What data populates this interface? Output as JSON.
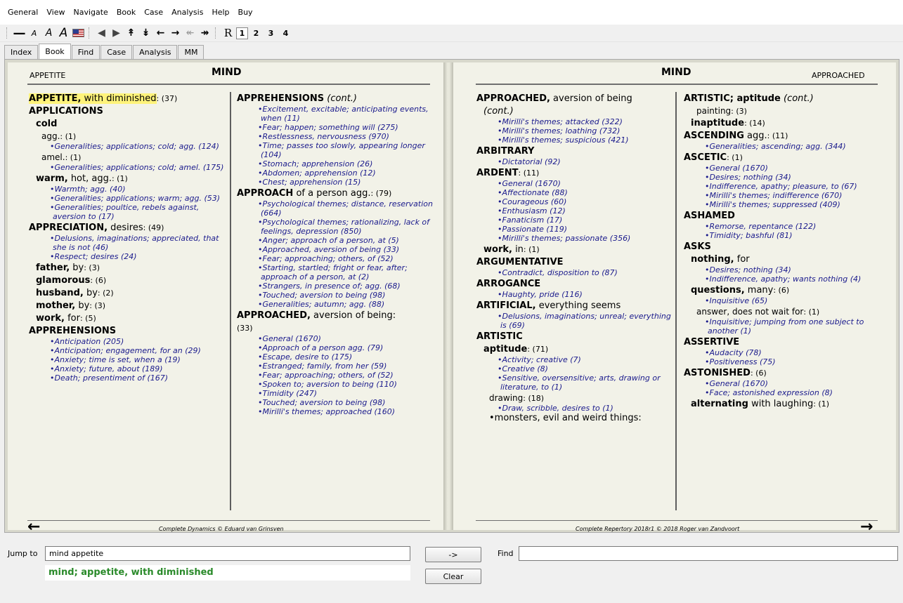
{
  "menu": [
    "General",
    "View",
    "Navigate",
    "Book",
    "Case",
    "Analysis",
    "Help",
    "Buy"
  ],
  "toolbar": {
    "r_label": "R",
    "levels": [
      "1",
      "2",
      "3",
      "4"
    ]
  },
  "tabs": [
    "Index",
    "Book",
    "Find",
    "Case",
    "Analysis",
    "MM"
  ],
  "left_page": {
    "header_label": "APPETITE",
    "header_title": "MIND",
    "footer": "Complete Dynamics © Eduard van Grinsven"
  },
  "right_page": {
    "header_label": "APPROACHED",
    "header_title": "MIND",
    "footer": "Complete Repertory 2018r1 © 2018 Roger van Zandvoort"
  },
  "jump": {
    "label": "Jump to",
    "value": "mind appetite",
    "result_prefix": "mind",
    "result_rest": "; appetite, with diminished"
  },
  "buttons": {
    "go": "->",
    "clear": "Clear"
  },
  "find": {
    "label": "Find",
    "value": ""
  },
  "columns": {
    "c1": [
      {
        "t": "h",
        "lvl": 0,
        "b": "APPETITE,",
        "n": " with diminished",
        "c": ": (37)",
        "hl": true
      },
      {
        "t": "h",
        "lvl": 0,
        "b": "APPLICATIONS"
      },
      {
        "t": "h",
        "lvl": 1,
        "b": "cold"
      },
      {
        "t": "h",
        "lvl": 2,
        "n": "agg.",
        "c": ": (1)"
      },
      {
        "t": "r",
        "x": "Generalities; applications; cold; agg. (124)"
      },
      {
        "t": "h",
        "lvl": 2,
        "n": "amel.",
        "c": ": (1)"
      },
      {
        "t": "r",
        "x": "Generalities; applications; cold; amel. (175)"
      },
      {
        "t": "h",
        "lvl": 1,
        "b": "warm,",
        "n": " hot, agg.",
        "c": ": (1)"
      },
      {
        "t": "r",
        "x": "Warmth; agg. (40)"
      },
      {
        "t": "r",
        "x": "Generalities; applications; warm; agg. (53)"
      },
      {
        "t": "r",
        "x": "Generalities; poultice, rebels against, aversion to (17)"
      },
      {
        "t": "h",
        "lvl": 0,
        "b": "APPRECIATION,",
        "n": " desires",
        "c": ": (49)"
      },
      {
        "t": "r",
        "x": "Delusions, imaginations; appreciated, that she is not (46)"
      },
      {
        "t": "r",
        "x": "Respect; desires (24)"
      },
      {
        "t": "h",
        "lvl": 1,
        "b": "father,",
        "n": " by",
        "c": ": (3)"
      },
      {
        "t": "h",
        "lvl": 1,
        "b": "glamorous",
        "c": ": (6)"
      },
      {
        "t": "h",
        "lvl": 1,
        "b": "husband,",
        "n": " by",
        "c": ": (2)"
      },
      {
        "t": "h",
        "lvl": 1,
        "b": "mother,",
        "n": " by",
        "c": ": (3)"
      },
      {
        "t": "h",
        "lvl": 1,
        "b": "work,",
        "n": " for",
        "c": ": (5)"
      },
      {
        "t": "h",
        "lvl": 0,
        "b": "APPREHENSIONS"
      },
      {
        "t": "r",
        "x": "Anticipation (205)"
      },
      {
        "t": "r",
        "x": "Anticipation; engagement, for an (29)"
      },
      {
        "t": "r",
        "x": "Anxiety; time is set, when a (19)"
      },
      {
        "t": "r",
        "x": "Anxiety; future, about (189)"
      },
      {
        "t": "r",
        "x": "Death; presentiment of (167)"
      }
    ],
    "c2": [
      {
        "t": "h",
        "lvl": 0,
        "b": "APPREHENSIONS",
        "i": " (cont.)"
      },
      {
        "t": "r",
        "x": "Excitement, excitable; anticipating events, when (11)"
      },
      {
        "t": "r",
        "x": "Fear; happen; something will (275)"
      },
      {
        "t": "r",
        "x": "Restlessness, nervousness (970)"
      },
      {
        "t": "r",
        "x": "Time; passes too slowly, appearing longer (104)"
      },
      {
        "t": "r",
        "x": "Stomach; apprehension (26)"
      },
      {
        "t": "r",
        "x": "Abdomen; apprehension (12)"
      },
      {
        "t": "r",
        "x": "Chest; apprehension (15)"
      },
      {
        "t": "h",
        "lvl": 0,
        "b": "APPROACH",
        "n": " of a person agg.",
        "c": ": (79)"
      },
      {
        "t": "r",
        "x": "Psychological themes; distance, reservation (664)"
      },
      {
        "t": "r",
        "x": "Psychological themes; rationalizing, lack of feelings, depression (850)"
      },
      {
        "t": "r",
        "x": "Anger; approach of a person, at (5)"
      },
      {
        "t": "r",
        "x": "Approached, aversion of being (33)"
      },
      {
        "t": "r",
        "x": "Fear; approaching; others, of (52)"
      },
      {
        "t": "r",
        "x": "Starting, startled; fright or fear, after; approach of a person, at (2)"
      },
      {
        "t": "r",
        "x": "Strangers, in presence of; agg. (68)"
      },
      {
        "t": "r",
        "x": "Touched; aversion to being (98)"
      },
      {
        "t": "r",
        "x": "Generalities; autumn; agg. (88)"
      },
      {
        "t": "h",
        "lvl": 0,
        "b": "APPROACHED,",
        "n": " aversion of being:"
      },
      {
        "t": "h",
        "lvl": 0,
        "c": "(33)"
      },
      {
        "t": "r",
        "x": "General (1670)"
      },
      {
        "t": "r",
        "x": "Approach of a person agg. (79)"
      },
      {
        "t": "r",
        "x": "Escape, desire to (175)"
      },
      {
        "t": "r",
        "x": "Estranged; family, from her (59)"
      },
      {
        "t": "r",
        "x": "Fear; approaching; others, of (52)"
      },
      {
        "t": "r",
        "x": "Spoken to; aversion to being (110)"
      },
      {
        "t": "r",
        "x": "Timidity (247)"
      },
      {
        "t": "r",
        "x": "Touched; aversion to being (98)"
      },
      {
        "t": "r",
        "x": "Mirilli's themes; approached (160)"
      }
    ],
    "c3": [
      {
        "t": "h",
        "lvl": 0,
        "b": "APPROACHED,",
        "n": " aversion of being"
      },
      {
        "t": "h",
        "lvl": 1,
        "i": "(cont.)"
      },
      {
        "t": "r",
        "x": "Mirilli's themes; attacked (322)"
      },
      {
        "t": "r",
        "x": "Mirilli's themes; loathing (732)"
      },
      {
        "t": "r",
        "x": "Mirilli's themes; suspicious (421)"
      },
      {
        "t": "h",
        "lvl": 0,
        "b": "ARBITRARY"
      },
      {
        "t": "r",
        "x": "Dictatorial (92)"
      },
      {
        "t": "h",
        "lvl": 0,
        "b": "ARDENT",
        "c": ": (11)"
      },
      {
        "t": "r",
        "x": "General (1670)"
      },
      {
        "t": "r",
        "x": "Affectionate (88)"
      },
      {
        "t": "r",
        "x": "Courageous (60)"
      },
      {
        "t": "r",
        "x": "Enthusiasm (12)"
      },
      {
        "t": "r",
        "x": "Fanaticism (17)"
      },
      {
        "t": "r",
        "x": "Passionate (119)"
      },
      {
        "t": "r",
        "x": "Mirilli's themes; passionate (356)"
      },
      {
        "t": "h",
        "lvl": 1,
        "b": "work,",
        "n": " in",
        "c": ": (1)"
      },
      {
        "t": "h",
        "lvl": 0,
        "b": "ARGUMENTATIVE"
      },
      {
        "t": "r",
        "x": "Contradict, disposition to (87)"
      },
      {
        "t": "h",
        "lvl": 0,
        "b": "ARROGANCE"
      },
      {
        "t": "r",
        "x": "Haughty, pride (116)"
      },
      {
        "t": "h",
        "lvl": 0,
        "b": "ARTIFICIAL,",
        "n": " everything seems"
      },
      {
        "t": "r",
        "x": "Delusions, imaginations; unreal; everything is (69)"
      },
      {
        "t": "h",
        "lvl": 0,
        "b": "ARTISTIC"
      },
      {
        "t": "h",
        "lvl": 1,
        "b": "aptitude",
        "c": ": (71)"
      },
      {
        "t": "r",
        "x": "Activity; creative (7)"
      },
      {
        "t": "r",
        "x": "Creative (8)"
      },
      {
        "t": "r",
        "x": "Sensitive, oversensitive; arts, drawing or literature, to (1)"
      },
      {
        "t": "h",
        "lvl": 2,
        "n": "drawing",
        "c": ": (18)"
      },
      {
        "t": "r",
        "x": "Draw, scribble, desires to (1)"
      },
      {
        "t": "p",
        "x": "monsters, evil and weird things:"
      }
    ],
    "c4": [
      {
        "t": "h",
        "lvl": 0,
        "b": "ARTISTIC; aptitude",
        "i": " (cont.)"
      },
      {
        "t": "h",
        "lvl": 2,
        "n": "painting",
        "c": ": (3)"
      },
      {
        "t": "h",
        "lvl": 1,
        "b": "inaptitude",
        "c": ": (14)"
      },
      {
        "t": "h",
        "lvl": 0,
        "b": "ASCENDING",
        "n": " agg.",
        "c": ": (11)"
      },
      {
        "t": "r",
        "x": "Generalities; ascending; agg. (344)"
      },
      {
        "t": "h",
        "lvl": 0,
        "b": "ASCETIC",
        "c": ": (1)"
      },
      {
        "t": "r",
        "x": "General (1670)"
      },
      {
        "t": "r",
        "x": "Desires; nothing (34)"
      },
      {
        "t": "r",
        "x": "Indifference, apathy; pleasure, to (67)"
      },
      {
        "t": "r",
        "x": "Mirilli's themes; indifference (670)"
      },
      {
        "t": "r",
        "x": "Mirilli's themes; suppressed (409)"
      },
      {
        "t": "h",
        "lvl": 0,
        "b": "ASHAMED"
      },
      {
        "t": "r",
        "x": "Remorse, repentance (122)"
      },
      {
        "t": "r",
        "x": "Timidity; bashful (81)"
      },
      {
        "t": "h",
        "lvl": 0,
        "b": "ASKS"
      },
      {
        "t": "h",
        "lvl": 1,
        "b": "nothing,",
        "n": " for"
      },
      {
        "t": "r",
        "x": "Desires; nothing (34)"
      },
      {
        "t": "r",
        "x": "Indifference, apathy; wants nothing (4)"
      },
      {
        "t": "h",
        "lvl": 1,
        "b": "questions,",
        "n": " many",
        "c": ": (6)"
      },
      {
        "t": "r",
        "x": "Inquisitive (65)"
      },
      {
        "t": "h",
        "lvl": 2,
        "n": "answer, does not wait for",
        "c": ": (1)"
      },
      {
        "t": "r",
        "x": "Inquisitive; jumping from one subject to another (1)"
      },
      {
        "t": "h",
        "lvl": 0,
        "b": "ASSERTIVE"
      },
      {
        "t": "r",
        "x": "Audacity (78)"
      },
      {
        "t": "r",
        "x": "Positiveness (75)"
      },
      {
        "t": "h",
        "lvl": 0,
        "b": "ASTONISHED",
        "c": ": (6)"
      },
      {
        "t": "r",
        "x": "General (1670)"
      },
      {
        "t": "r",
        "x": "Face; astonished expression (8)"
      },
      {
        "t": "h",
        "lvl": 1,
        "b": "alternating",
        "n": " with laughing",
        "c": ": (1)"
      }
    ]
  }
}
